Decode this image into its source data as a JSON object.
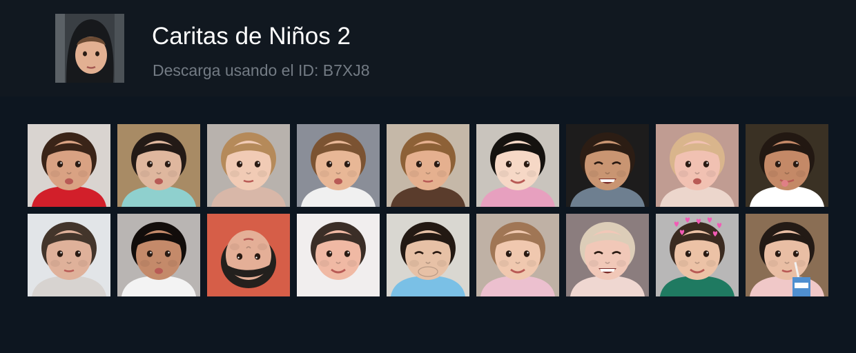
{
  "pack": {
    "title": "Caritas de Niños 2",
    "subtitle": "Descarga usando el ID: B7XJ8",
    "cover_icon": "child-hoodie-face-icon"
  },
  "colors": {
    "header_bg": "#111820",
    "page_bg": "#0d1620",
    "title_text": "#ffffff",
    "subtitle_text": "#737b84"
  },
  "stickers": [
    {
      "icon": "child-kiss-face-icon",
      "bg": "#d9d4d0",
      "skin": "#d9a283",
      "hair": "#3a2418",
      "shirt": "#d21f2a",
      "expr": "pout"
    },
    {
      "icon": "child-chin-rest-face-icon",
      "bg": "#a88b65",
      "skin": "#dfb79e",
      "hair": "#231a16",
      "shirt": "#8fd0ce",
      "expr": "pout"
    },
    {
      "icon": "child-curly-hair-face-icon",
      "bg": "#b8b2ad",
      "skin": "#f1cbb5",
      "hair": "#b58a5a",
      "shirt": "#d8b7a8",
      "expr": "neutral"
    },
    {
      "icon": "child-pucker-face-icon",
      "bg": "#8a8e98",
      "skin": "#e8b796",
      "hair": "#7b5332",
      "shirt": "#f0f0f0",
      "expr": "pout"
    },
    {
      "icon": "child-close-up-face-icon",
      "bg": "#c5b8a8",
      "skin": "#e5b08f",
      "hair": "#8d6137",
      "shirt": "#5a3c2c",
      "expr": "neutral"
    },
    {
      "icon": "child-bangs-smile-face-icon",
      "bg": "#c9c4bd",
      "skin": "#f6d8c6",
      "hair": "#15120f",
      "shirt": "#e7a0bf",
      "expr": "smile"
    },
    {
      "icon": "child-grin-face-icon",
      "bg": "#1d1c1c",
      "skin": "#c99572",
      "hair": "#2c1d14",
      "shirt": "#6e7f90",
      "expr": "grin"
    },
    {
      "icon": "child-blonde-face-icon",
      "bg": "#c09c92",
      "skin": "#f1c1b2",
      "hair": "#d9b58c",
      "shirt": "#ecd6cc",
      "expr": "pout"
    },
    {
      "icon": "child-tongue-out-face-icon",
      "bg": "#3a3124",
      "skin": "#c48967",
      "hair": "#221812",
      "shirt": "#ffffff",
      "expr": "tongue"
    },
    {
      "icon": "child-thumb-sucking-face-icon",
      "bg": "#e2e5e8",
      "skin": "#dfb19a",
      "hair": "#43352b",
      "shirt": "#d7d3d0",
      "expr": "neutral"
    },
    {
      "icon": "child-afro-face-icon",
      "bg": "#b9b5b3",
      "skin": "#c48a6a",
      "hair": "#120d0b",
      "shirt": "#f3f3f3",
      "expr": "pout"
    },
    {
      "icon": "child-upside-down-face-icon",
      "bg": "#d65e48",
      "skin": "#e4af97",
      "hair": "#23201d",
      "shirt": "#d65e48",
      "expr": "upside"
    },
    {
      "icon": "child-chubby-smile-face-icon",
      "bg": "#f1eeee",
      "skin": "#f0b9a4",
      "hair": "#3b2e27",
      "shirt": "#f1eeee",
      "expr": "smile"
    },
    {
      "icon": "child-giggle-face-icon",
      "bg": "#d9d7d1",
      "skin": "#e7c1a6",
      "hair": "#231913",
      "shirt": "#7ac0e6",
      "expr": "giggle"
    },
    {
      "icon": "child-smile-face-icon",
      "bg": "#bfb1a5",
      "skin": "#f0c8af",
      "hair": "#a07655",
      "shirt": "#ecc0cf",
      "expr": "smile"
    },
    {
      "icon": "child-laugh-face-icon",
      "bg": "#8b7d7e",
      "skin": "#f1c8b8",
      "hair": "#dccdb8",
      "shirt": "#efd7d1",
      "expr": "grin"
    },
    {
      "icon": "child-hearts-crown-face-icon",
      "bg": "#b8b7b7",
      "skin": "#ecc2a6",
      "hair": "#3a2a20",
      "shirt": "#1f7a61",
      "expr": "smile",
      "hearts": true
    },
    {
      "icon": "child-juice-box-face-icon",
      "bg": "#8a6e54",
      "skin": "#e9bea4",
      "hair": "#231a15",
      "shirt": "#f0c8c8",
      "expr": "straw"
    }
  ]
}
